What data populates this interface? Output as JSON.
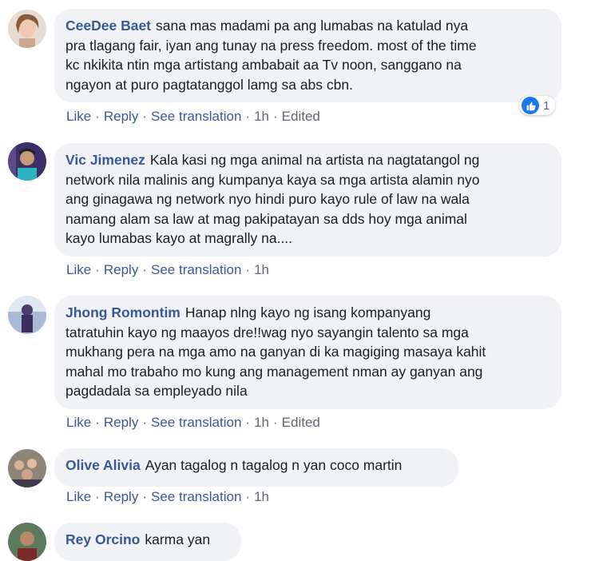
{
  "comments": [
    {
      "author": "CeeDee Baet",
      "text": "sana mas madami pa ang lumabas na katulad nya\npra tlagang fair, iyan ang tunay na press freedom. most of the time\nkc nkikita ntin mga artistang ambabait aa Tv noon, sanggano na\nngayon at puro pagtatanggol lamg sa abs cbn.",
      "like": "Like",
      "reply": "Reply",
      "translate": "See translation",
      "time": "1h",
      "edited": "Edited",
      "reaction_count": "1"
    },
    {
      "author": "Vic Jimenez",
      "text": "Kala kasi ng mga animal na artista na nagtatangol ng\nnetwork nila malinis ang kumpanya kaya sa mga artista alamin nyo\nang ginagawa ng network nyo hindi puro kayo rule of law na wala\nnamang alam sa law at mag pakipatayan sa dds hoy mga animal\nkayo lumabas kayo at magrally na....",
      "like": "Like",
      "reply": "Reply",
      "translate": "See translation",
      "time": "1h"
    },
    {
      "author": "Jhong Romontim",
      "text": "Hanap nlng kayo ng isang kompanyang\ntatratuhin kayo ng maayos dre!!wag nyo sayangin talento sa mga\nmukhang pera na mga amo na ganyan di ka magiging masaya kahit\nmahal mo trabaho mo kung ang management nman ay ganyan ang\npagdadala sa empleyado nila",
      "like": "Like",
      "reply": "Reply",
      "translate": "See translation",
      "time": "1h",
      "edited": "Edited"
    },
    {
      "author": "Olive Alivia",
      "text": "Ayan tagalog n tagalog n yan coco martin",
      "like": "Like",
      "reply": "Reply",
      "translate": "See translation",
      "time": "1h"
    },
    {
      "author": "Rey Orcino",
      "text": "karma yan"
    }
  ],
  "colors": {
    "author": "#385898",
    "bubble": "#f0f2f5",
    "meta": "#606770",
    "like_badge": "#1877f2"
  },
  "icons": {
    "reaction": "thumbs-up-icon"
  }
}
